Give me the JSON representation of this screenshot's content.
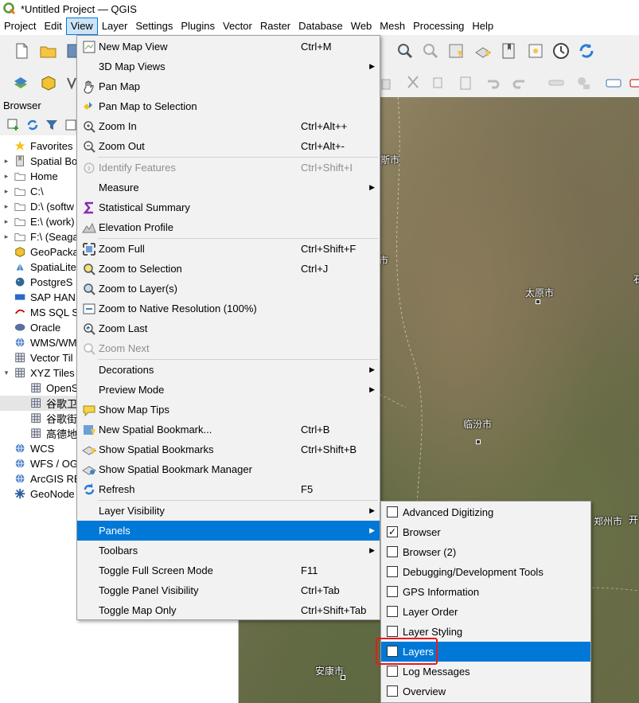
{
  "window": {
    "title": "*Untitled Project — QGIS"
  },
  "menubar": {
    "items": [
      {
        "label": "Project"
      },
      {
        "label": "Edit"
      },
      {
        "label": "View"
      },
      {
        "label": "Layer"
      },
      {
        "label": "Settings"
      },
      {
        "label": "Plugins"
      },
      {
        "label": "Vector"
      },
      {
        "label": "Raster"
      },
      {
        "label": "Database"
      },
      {
        "label": "Web"
      },
      {
        "label": "Mesh"
      },
      {
        "label": "Processing"
      },
      {
        "label": "Help"
      }
    ],
    "active": "View"
  },
  "browser": {
    "title": "Browser",
    "items": [
      {
        "label": "Favorites",
        "icon": "star-icon",
        "arrow": ""
      },
      {
        "label": "Spatial Bo",
        "icon": "bookmark-icon",
        "arrow": "▸"
      },
      {
        "label": "Home",
        "icon": "folder-icon",
        "arrow": "▸"
      },
      {
        "label": "C:\\",
        "icon": "folder-icon",
        "arrow": "▸"
      },
      {
        "label": "D:\\ (softw",
        "icon": "folder-icon",
        "arrow": "▸"
      },
      {
        "label": "E:\\ (work)",
        "icon": "folder-icon",
        "arrow": "▸"
      },
      {
        "label": "F:\\ (Seaga",
        "icon": "folder-icon",
        "arrow": "▸"
      },
      {
        "label": "GeoPacka",
        "icon": "geopackage-icon",
        "arrow": ""
      },
      {
        "label": "SpatiaLite",
        "icon": "spatialite-icon",
        "arrow": ""
      },
      {
        "label": "PostgreS",
        "icon": "postgres-icon",
        "arrow": ""
      },
      {
        "label": "SAP HAN",
        "icon": "sap-hana-icon",
        "arrow": ""
      },
      {
        "label": "MS SQL S",
        "icon": "mssql-icon",
        "arrow": ""
      },
      {
        "label": "Oracle",
        "icon": "oracle-icon",
        "arrow": ""
      },
      {
        "label": "WMS/WM",
        "icon": "globe-icon",
        "arrow": ""
      },
      {
        "label": "Vector Til",
        "icon": "grid-icon",
        "arrow": ""
      },
      {
        "label": "XYZ Tiles",
        "icon": "grid-icon",
        "arrow": "▾"
      },
      {
        "label": "OpenS",
        "icon": "grid-icon",
        "arrow": "",
        "indent": true
      },
      {
        "label": "谷歌卫",
        "icon": "grid-icon",
        "arrow": "",
        "indent": true,
        "selected": true
      },
      {
        "label": "谷歌街",
        "icon": "grid-icon",
        "arrow": "",
        "indent": true
      },
      {
        "label": "高德地",
        "icon": "grid-icon",
        "arrow": "",
        "indent": true
      },
      {
        "label": "WCS",
        "icon": "globe-icon",
        "arrow": ""
      },
      {
        "label": "WFS / OG",
        "icon": "globe-icon",
        "arrow": ""
      },
      {
        "label": "ArcGIS RE",
        "icon": "globe-icon",
        "arrow": ""
      },
      {
        "label": "GeoNode",
        "icon": "geonode-icon",
        "arrow": ""
      }
    ]
  },
  "map": {
    "labels": [
      "斯市",
      "市",
      "太原市",
      "临汾市",
      "郑州市",
      "开",
      "石",
      "安康市"
    ]
  },
  "view_menu": {
    "items": [
      {
        "label": "New Map View",
        "shortcut": "Ctrl+M",
        "icon": "new-map-view-icon"
      },
      {
        "label": "3D Map Views",
        "shortcut": "",
        "icon": "",
        "submenu": true
      },
      {
        "label": "Pan Map",
        "shortcut": "",
        "icon": "pan-hand-icon"
      },
      {
        "label": "Pan Map to Selection",
        "shortcut": "",
        "icon": "pan-selection-icon"
      },
      {
        "label": "Zoom In",
        "shortcut": "Ctrl+Alt++",
        "icon": "zoom-in-icon"
      },
      {
        "label": "Zoom Out",
        "shortcut": "Ctrl+Alt+-",
        "icon": "zoom-out-icon"
      },
      {
        "label": "Identify Features",
        "shortcut": "Ctrl+Shift+I",
        "icon": "identify-icon",
        "disabled": true
      },
      {
        "label": "Measure",
        "shortcut": "",
        "icon": "",
        "submenu": true
      },
      {
        "label": "Statistical Summary",
        "shortcut": "",
        "icon": "sigma-icon"
      },
      {
        "label": "Elevation Profile",
        "shortcut": "",
        "icon": "elevation-profile-icon"
      },
      {
        "label": "Zoom Full",
        "shortcut": "Ctrl+Shift+F",
        "icon": "zoom-full-icon"
      },
      {
        "label": "Zoom to Selection",
        "shortcut": "Ctrl+J",
        "icon": "zoom-selection-icon"
      },
      {
        "label": "Zoom to Layer(s)",
        "shortcut": "",
        "icon": "zoom-layer-icon"
      },
      {
        "label": "Zoom to Native Resolution (100%)",
        "shortcut": "",
        "icon": "zoom-native-icon"
      },
      {
        "label": "Zoom Last",
        "shortcut": "",
        "icon": "zoom-last-icon"
      },
      {
        "label": "Zoom Next",
        "shortcut": "",
        "icon": "zoom-next-icon",
        "disabled": true
      },
      {
        "label": "Decorations",
        "shortcut": "",
        "icon": "",
        "submenu": true
      },
      {
        "label": "Preview Mode",
        "shortcut": "",
        "icon": "",
        "submenu": true
      },
      {
        "label": "Show Map Tips",
        "shortcut": "",
        "icon": "map-tips-icon"
      },
      {
        "label": "New Spatial Bookmark...",
        "shortcut": "Ctrl+B",
        "icon": "new-bookmark-icon"
      },
      {
        "label": "Show Spatial Bookmarks",
        "shortcut": "Ctrl+Shift+B",
        "icon": "show-bookmarks-icon"
      },
      {
        "label": "Show Spatial Bookmark Manager",
        "shortcut": "",
        "icon": "bookmark-manager-icon"
      },
      {
        "label": "Refresh",
        "shortcut": "F5",
        "icon": "refresh-icon"
      },
      {
        "label": "Layer Visibility",
        "shortcut": "",
        "icon": "",
        "submenu": true
      },
      {
        "label": "Panels",
        "shortcut": "",
        "icon": "",
        "submenu": true,
        "highlighted": true
      },
      {
        "label": "Toolbars",
        "shortcut": "",
        "icon": "",
        "submenu": true
      },
      {
        "label": "Toggle Full Screen Mode",
        "shortcut": "F11",
        "icon": ""
      },
      {
        "label": "Toggle Panel Visibility",
        "shortcut": "Ctrl+Tab",
        "icon": ""
      },
      {
        "label": "Toggle Map Only",
        "shortcut": "Ctrl+Shift+Tab",
        "icon": ""
      }
    ]
  },
  "panels_menu": {
    "items": [
      {
        "label": "Advanced Digitizing",
        "checked": false
      },
      {
        "label": "Browser",
        "checked": true
      },
      {
        "label": "Browser (2)",
        "checked": false
      },
      {
        "label": "Debugging/Development Tools",
        "checked": false
      },
      {
        "label": "GPS Information",
        "checked": false
      },
      {
        "label": "Layer Order",
        "checked": false
      },
      {
        "label": "Layer Styling",
        "checked": false
      },
      {
        "label": "Layers",
        "checked": false,
        "highlighted": true
      },
      {
        "label": "Log Messages",
        "checked": false
      },
      {
        "label": "Overview",
        "checked": false
      }
    ],
    "checkmark": "✓"
  },
  "colors": {
    "highlight": "#0078d7",
    "annotation": "#e81a1a"
  }
}
